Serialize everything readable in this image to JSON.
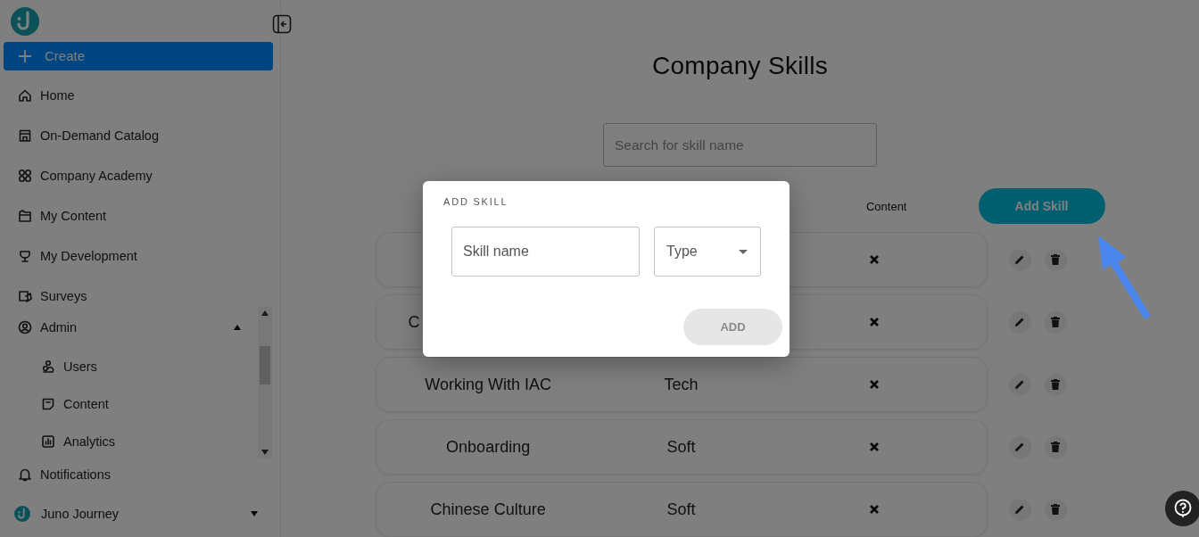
{
  "sidebar": {
    "create_button": "Create",
    "items": [
      {
        "label": "Home"
      },
      {
        "label": "On-Demand Catalog"
      },
      {
        "label": "Company Academy"
      },
      {
        "label": "My Content"
      },
      {
        "label": "My Development"
      },
      {
        "label": "Surveys"
      }
    ],
    "admin": {
      "label": "Admin",
      "expanded": true,
      "children": [
        {
          "label": "Users"
        },
        {
          "label": "Content"
        },
        {
          "label": "Analytics"
        }
      ]
    },
    "notifications": "Notifications",
    "workspace": "Juno Journey"
  },
  "page": {
    "title": "Company Skills",
    "search": {
      "placeholder": "Search for skill name"
    },
    "columns": [
      {
        "label": "Content"
      }
    ],
    "add_button": "Add Skill",
    "rows": [
      {
        "has_content": false
      },
      {
        "name": "C",
        "clipped": true,
        "has_content": false
      },
      {
        "name": "Working With IAC",
        "type": "Tech",
        "has_content": false
      },
      {
        "name": "Onboarding",
        "type": "Soft",
        "has_content": false
      },
      {
        "name": "Chinese Culture",
        "type": "Soft",
        "has_content": false
      }
    ]
  },
  "dialog": {
    "title": "ADD SKILL",
    "name_field": {
      "placeholder": "Skill name"
    },
    "type_select": {
      "placeholder": "Type"
    },
    "add_button": {
      "label": "ADD",
      "disabled": true
    }
  }
}
